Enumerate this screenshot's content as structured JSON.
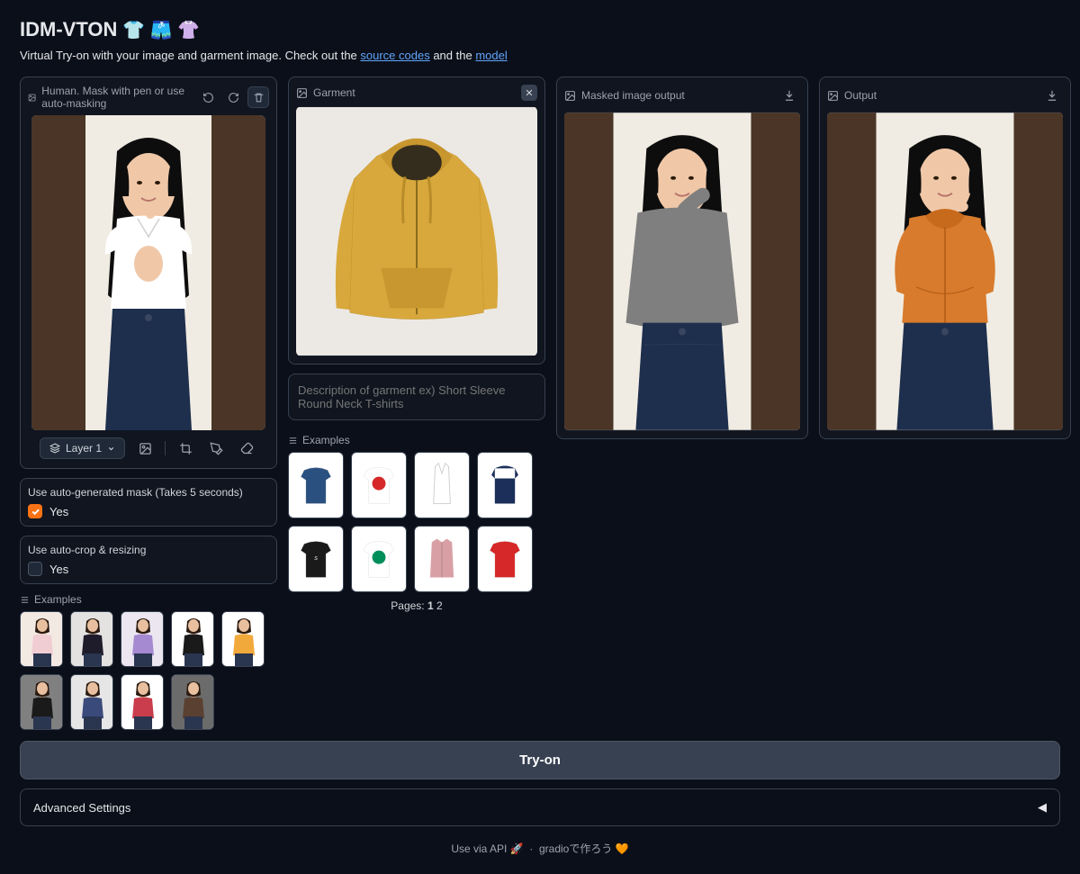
{
  "header": {
    "title": "IDM-VTON",
    "emojis": "👕 🩳 👚",
    "subtitle_prefix": "Virtual Try-on with your image and garment image. Check out the ",
    "link1": "source codes",
    "subtitle_mid": " and the ",
    "link2": "model"
  },
  "panels": {
    "human_label": "Human. Mask with pen or use auto-masking",
    "garment_label": "Garment",
    "masked_label": "Masked image output",
    "output_label": "Output"
  },
  "toolbar": {
    "layer1": "Layer 1"
  },
  "options": {
    "automask_label": "Use auto-generated mask (Takes 5 seconds)",
    "automask_value": "Yes",
    "autocrop_label": "Use auto-crop & resizing",
    "autocrop_value": "Yes"
  },
  "garment_desc_placeholder": "Description of garment ex) Short Sleeve Round Neck T-shirts",
  "examples_label": "Examples",
  "pages_label": "Pages:",
  "pages_current": "1",
  "pages_other": "2",
  "tryon_label": "Try-on",
  "advanced_label": "Advanced Settings",
  "footer": {
    "api": "Use via API 🚀",
    "sep": "·",
    "gradio": "gradioで作ろう 🧡"
  },
  "human_examples": [
    {
      "bg": "#f3e9e3",
      "top": "#f0cdd3"
    },
    {
      "bg": "#e4e2e0",
      "top": "#1e1c2a"
    },
    {
      "bg": "#ebe6f0",
      "top": "#a58ad1"
    },
    {
      "bg": "#ffffff",
      "top": "#1a1a1a"
    },
    {
      "bg": "#ffffff",
      "top": "#f2a93b"
    },
    {
      "bg": "#808080",
      "top": "#1a1a1a"
    },
    {
      "bg": "#e6e6e6",
      "top": "#3a4a7a"
    },
    {
      "bg": "#ffffff",
      "top": "#c93d4d"
    },
    {
      "bg": "#6b6b6b",
      "top": "#5a4030"
    }
  ],
  "garment_examples": [
    {
      "fill": "#2a5080",
      "type": "tee"
    },
    {
      "fill": "#ffffff",
      "type": "graphic",
      "accent": "#d62828"
    },
    {
      "fill": "#ffffff",
      "type": "tank"
    },
    {
      "fill": "#1b2f5a",
      "type": "polo",
      "accent": "#ffffff"
    },
    {
      "fill": "#1a1a1a",
      "type": "tee",
      "text": "Stüssy"
    },
    {
      "fill": "#ffffff",
      "type": "tee",
      "accent": "#008f5a"
    },
    {
      "fill": "#d8a0a5",
      "type": "shirt"
    },
    {
      "fill": "#d62828",
      "type": "tee"
    }
  ]
}
